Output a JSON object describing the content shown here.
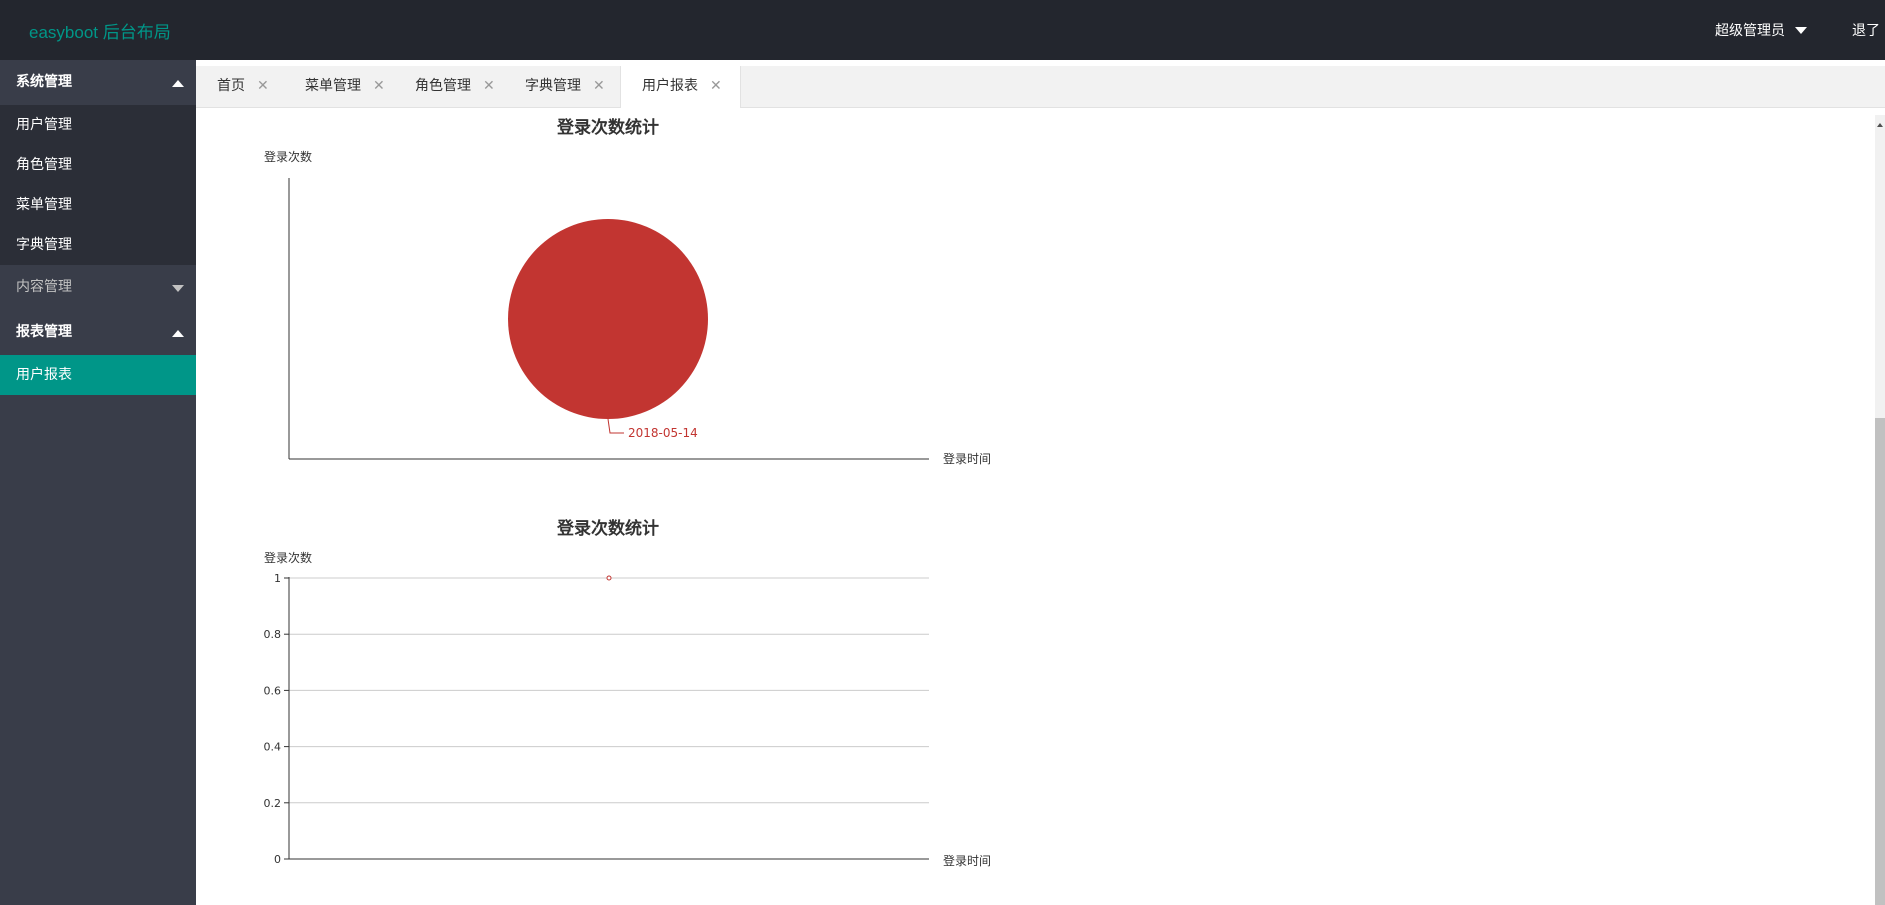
{
  "header": {
    "logo": "easyboot 后台布局",
    "user": "超级管理员",
    "logout": "退了"
  },
  "sidebar": {
    "groups": [
      {
        "label": "系统管理",
        "expanded": true,
        "items": [
          "用户管理",
          "角色管理",
          "菜单管理",
          "字典管理"
        ]
      },
      {
        "label": "内容管理",
        "expanded": false,
        "items": []
      },
      {
        "label": "报表管理",
        "expanded": true,
        "items": [
          "用户报表"
        ]
      }
    ],
    "active_item": "用户报表"
  },
  "tabs": [
    {
      "label": "首页",
      "active": false
    },
    {
      "label": "菜单管理",
      "active": false
    },
    {
      "label": "角色管理",
      "active": false
    },
    {
      "label": "字典管理",
      "active": false
    },
    {
      "label": "用户报表",
      "active": true
    }
  ],
  "chart_data": [
    {
      "type": "pie",
      "title": "登录次数统计",
      "ylabel": "登录次数",
      "xlabel": "登录时间",
      "slices": [
        {
          "label": "2018-05-14",
          "value": 1
        }
      ],
      "color": "#c23531"
    },
    {
      "type": "line",
      "title": "登录次数统计",
      "ylabel": "登录次数",
      "xlabel": "登录时间",
      "ylim": [
        0,
        1
      ],
      "yticks": [
        "0",
        "0.2",
        "0.4",
        "0.6",
        "0.8",
        "1"
      ],
      "series": [
        {
          "values": [
            1
          ]
        }
      ],
      "grid": true,
      "color": "#c23531"
    }
  ]
}
